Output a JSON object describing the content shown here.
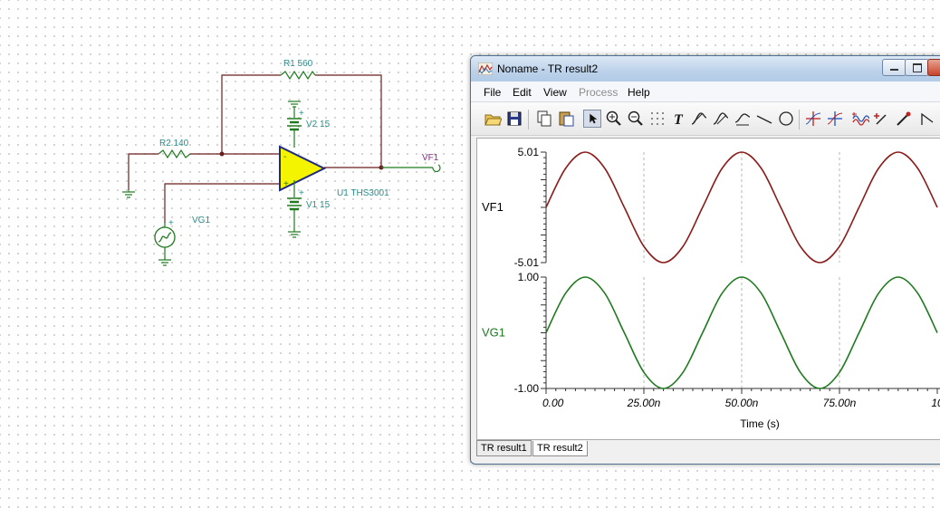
{
  "schematic": {
    "r1_label": "R1 560",
    "r2_label": "R2 140",
    "v2_label": "V2 15",
    "v1_label": "V1 15",
    "u1_label": "U1 THS3001",
    "vf1_label": "VF1",
    "vg1_label": "VG1",
    "plus": "+",
    "minus": "-"
  },
  "window": {
    "title": "Noname - TR result2"
  },
  "menu": {
    "items": [
      "File",
      "Edit",
      "View",
      "Process",
      "Help"
    ],
    "disabled": [
      "Process"
    ]
  },
  "toolbar": {
    "tools": [
      "open-icon",
      "save-icon",
      "copy-icon",
      "paste-icon",
      "pointer-icon",
      "zoom-in-icon",
      "zoom-100-icon",
      "grid-icon",
      "text-icon",
      "cursor-a-icon",
      "cursor-b-icon",
      "curve-icon",
      "line-icon",
      "circle-icon",
      "cursor-a-marker-icon",
      "cursor-b-marker-icon",
      "wave-icon",
      "marker-icon",
      "pen-icon",
      "step-icon",
      "scroll-left-icon"
    ],
    "pressed": "pointer-icon"
  },
  "tabs": [
    "TR result1",
    "TR result2"
  ],
  "active_tab": "TR result2",
  "chart_data": {
    "type": "line",
    "xlabel": "Time (s)",
    "x_ticks": [
      "0.00",
      "25.00n",
      "50.00n",
      "75.00n",
      "10"
    ],
    "x_range_ns": [
      0,
      100
    ],
    "series": [
      {
        "name": "VF1",
        "color": "#8b1a1a",
        "ylim": [
          -5.01,
          5.01
        ],
        "ytick_labels": [
          "5.01",
          "-5.01"
        ],
        "x_ns": [
          0,
          5,
          10,
          15,
          20,
          25,
          30,
          35,
          40,
          45,
          50,
          55,
          60,
          65,
          70,
          75,
          80,
          85,
          90,
          95,
          100
        ],
        "values": [
          0,
          3.54,
          5.01,
          3.54,
          0,
          -3.54,
          -5.01,
          -3.54,
          0,
          3.54,
          5.01,
          3.54,
          0,
          -3.54,
          -5.01,
          -3.54,
          0,
          3.54,
          5.01,
          3.54,
          0
        ]
      },
      {
        "name": "VG1",
        "color": "#1f7a1f",
        "ylim": [
          -1.0,
          1.0
        ],
        "ytick_labels": [
          "1.00",
          "-1.00"
        ],
        "x_ns": [
          0,
          5,
          10,
          15,
          20,
          25,
          30,
          35,
          40,
          45,
          50,
          55,
          60,
          65,
          70,
          75,
          80,
          85,
          90,
          95,
          100
        ],
        "values": [
          0,
          0.71,
          1.0,
          0.71,
          0,
          -0.71,
          -1.0,
          -0.71,
          0,
          0.71,
          1.0,
          0.71,
          0,
          -0.71,
          -1.0,
          -0.71,
          0,
          0.71,
          1.0,
          0.71,
          0
        ]
      }
    ]
  }
}
